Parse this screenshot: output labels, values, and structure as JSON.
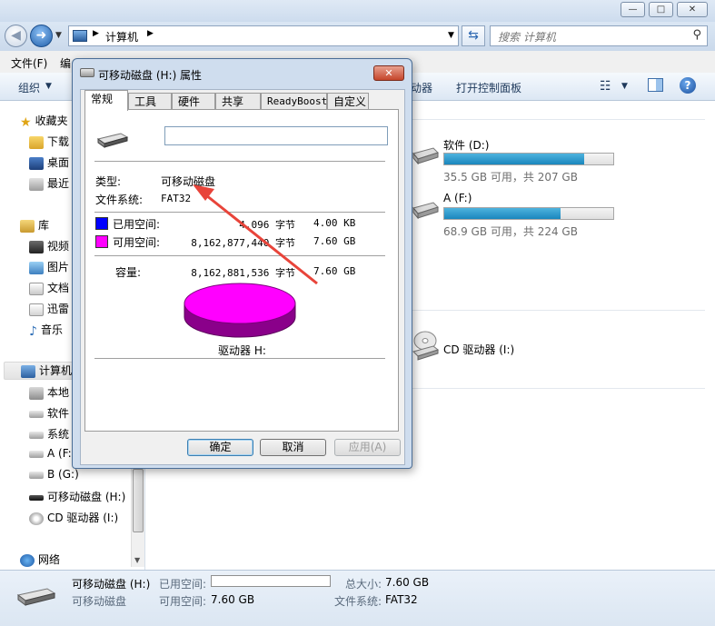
{
  "window": {
    "title_buttons": [
      "—",
      "□",
      "✕"
    ],
    "breadcrumb": [
      "计算机"
    ],
    "search_placeholder": "搜索 计算机"
  },
  "menu": [
    "文件(F)",
    "编"
  ],
  "toolbar": {
    "organize": "组织",
    "drives_partial": "动器",
    "control_panel": "打开控制面板"
  },
  "nav": {
    "favorites": "收藏夹",
    "downloads": "下载",
    "desktop": "桌面",
    "recent": "最近",
    "libraries": "库",
    "videos": "视频",
    "pictures": "图片",
    "documents": "文档",
    "xunlei": "迅雷",
    "music": "音乐",
    "computer": "计算机",
    "local": "本地",
    "software": "软件",
    "system": "系统",
    "a_drive": "A (F:",
    "b_drive": "B (G:)",
    "removable": "可移动磁盘 (H:)",
    "cd_drive": "CD 驱动器 (I:)",
    "network": "网络"
  },
  "drives": [
    {
      "name": "软件 (D:)",
      "free_text": "35.5 GB 可用，共 207 GB",
      "used_fraction": 0.83
    },
    {
      "name": "A (F:)",
      "free_text": "68.9 GB 可用，共 224 GB",
      "used_fraction": 0.69
    },
    {
      "name": "CD 驱动器 (I:)"
    }
  ],
  "details": {
    "name": "可移动磁盘 (H:)",
    "type": "可移动磁盘",
    "used_label": "已用空间:",
    "used_fraction": 0.0,
    "free_label": "可用空间:",
    "free_value": "7.60 GB",
    "total_label": "总大小:",
    "total_value": "7.60 GB",
    "fs_label": "文件系统:",
    "fs_value": "FAT32"
  },
  "dialog": {
    "title": "可移动磁盘 (H:) 属性",
    "tabs": [
      "常规",
      "工具",
      "硬件",
      "共享",
      "ReadyBoost",
      "自定义"
    ],
    "active_tab": "常规",
    "name_value": "",
    "type_label": "类型:",
    "type_value": "可移动磁盘",
    "fs_label": "文件系统:",
    "fs_value": "FAT32",
    "used": {
      "label": "已用空间:",
      "bytes": "4,096 字节",
      "size": "4.00 KB",
      "color": "#0000ff"
    },
    "free": {
      "label": "可用空间:",
      "bytes": "8,162,877,440 字节",
      "size": "7.60 GB",
      "color": "#ff00ff"
    },
    "capacity": {
      "label": "容量:",
      "bytes": "8,162,881,536 字节",
      "size": "7.60 GB"
    },
    "drive_label": "驱动器 H:",
    "buttons": {
      "ok": "确定",
      "cancel": "取消",
      "apply": "应用(A)"
    }
  }
}
